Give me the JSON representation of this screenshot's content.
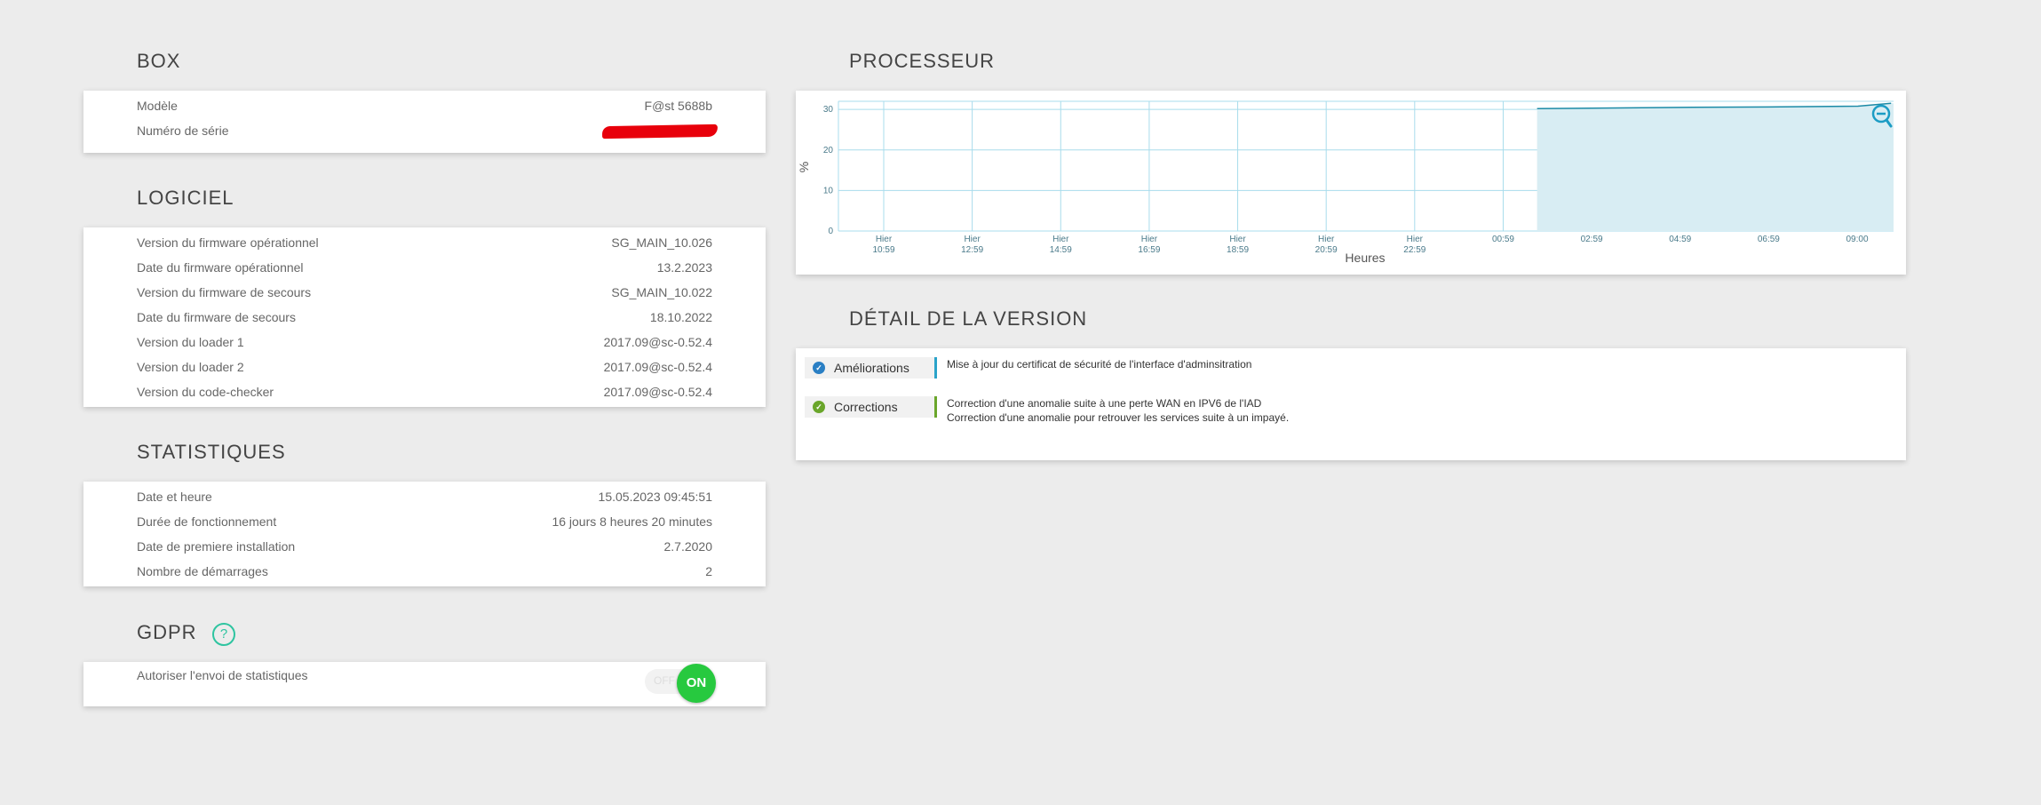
{
  "box": {
    "title": "BOX",
    "rows": [
      {
        "label": "Modèle",
        "value": "F@st 5688b"
      },
      {
        "label": "Numéro de série",
        "value": ""
      }
    ]
  },
  "logiciel": {
    "title": "LOGICIEL",
    "rows": [
      {
        "label": "Version du firmware opérationnel",
        "value": "SG_MAIN_10.026"
      },
      {
        "label": "Date du firmware opérationnel",
        "value": "13.2.2023"
      },
      {
        "label": "Version du firmware de secours",
        "value": "SG_MAIN_10.022"
      },
      {
        "label": "Date du firmware de secours",
        "value": "18.10.2022"
      },
      {
        "label": "Version du loader 1",
        "value": "2017.09@sc-0.52.4"
      },
      {
        "label": "Version du loader 2",
        "value": "2017.09@sc-0.52.4"
      },
      {
        "label": "Version du code-checker",
        "value": "2017.09@sc-0.52.4"
      }
    ]
  },
  "statistiques": {
    "title": "STATISTIQUES",
    "rows": [
      {
        "label": "Date et heure",
        "value": "15.05.2023 09:45:51"
      },
      {
        "label": "Durée de fonctionnement",
        "value": "16 jours 8 heures 20 minutes"
      },
      {
        "label": "Date de premiere installation",
        "value": "2.7.2020"
      },
      {
        "label": "Nombre de démarrages",
        "value": "2"
      }
    ]
  },
  "gdpr": {
    "title": "GDPR",
    "help_icon": "?",
    "row_label": "Autoriser l'envoi de statistiques",
    "toggle_off": "OFF",
    "toggle_on": "ON",
    "toggle_state": "on"
  },
  "processeur": {
    "title": "PROCESSEUR",
    "zoom_icon": "zoom-out-icon"
  },
  "chart_data": {
    "type": "area",
    "ylabel": "%",
    "xlabel": "Heures",
    "ylim": [
      0,
      32
    ],
    "yticks": [
      0,
      10,
      20,
      30
    ],
    "xticks": [
      {
        "line1": "Hier",
        "line2": "10:59"
      },
      {
        "line1": "Hier",
        "line2": "12:59"
      },
      {
        "line1": "Hier",
        "line2": "14:59"
      },
      {
        "line1": "Hier",
        "line2": "16:59"
      },
      {
        "line1": "Hier",
        "line2": "18:59"
      },
      {
        "line1": "Hier",
        "line2": "20:59"
      },
      {
        "line1": "Hier",
        "line2": "22:59"
      },
      {
        "line1": "",
        "line2": "00:59"
      },
      {
        "line1": "",
        "line2": "02:59"
      },
      {
        "line1": "",
        "line2": "04:59"
      },
      {
        "line1": "",
        "line2": "06:59"
      },
      {
        "line1": "",
        "line2": "09:00"
      }
    ],
    "series": [
      {
        "values": [
          {
            "t": "01:45",
            "y": 30.2
          },
          {
            "t": "02:59",
            "y": 30.3
          },
          {
            "t": "04:59",
            "y": 30.5
          },
          {
            "t": "06:59",
            "y": 30.6
          },
          {
            "t": "09:00",
            "y": 30.8
          },
          {
            "t": "09:45",
            "y": 31.5
          }
        ]
      }
    ],
    "grid": true,
    "fill_color": "#d8edf3",
    "line_color": "#1b8aa6",
    "grid_color": "#a8dcec"
  },
  "version": {
    "title": "DÉTAIL DE LA VERSION",
    "items": [
      {
        "tag": "Améliorations",
        "check_color": "#2a7fc4",
        "bar_color": "#2aa3c9",
        "lines": [
          "Mise à jour du certificat de sécurité de l'interface d'adminsitration"
        ]
      },
      {
        "tag": "Corrections",
        "check_color": "#6aa62b",
        "bar_color": "#6aa62b",
        "lines": [
          "Correction d'une anomalie suite à une perte WAN en IPV6 de l'IAD",
          "Correction d'une anomalie pour retrouver les services suite à un impayé."
        ]
      }
    ]
  }
}
